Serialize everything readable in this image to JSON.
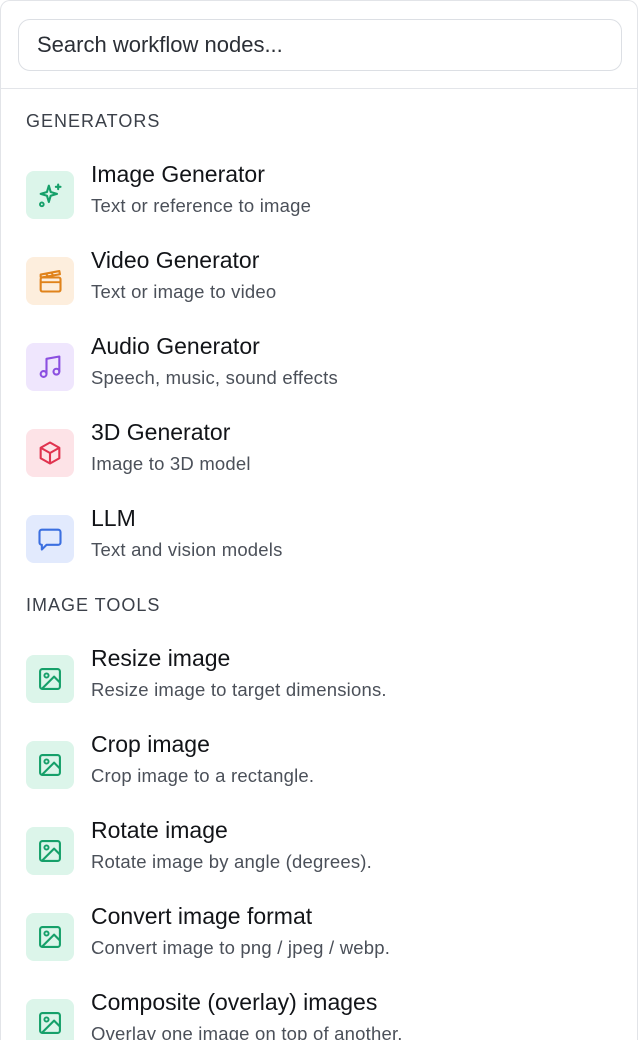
{
  "search": {
    "placeholder": "Search workflow nodes..."
  },
  "sections": [
    {
      "title": "GENERATORS",
      "items": [
        {
          "title": "Image Generator",
          "desc": "Text or reference to image",
          "icon": "sparkles-icon",
          "icon_color": "#16a06a",
          "icon_bg": "#dcf5ea"
        },
        {
          "title": "Video Generator",
          "desc": "Text or image to video",
          "icon": "clapperboard-icon",
          "icon_color": "#e0831b",
          "icon_bg": "#fdeedd"
        },
        {
          "title": "Audio Generator",
          "desc": "Speech, music, sound effects",
          "icon": "music-note-icon",
          "icon_color": "#8b4fe0",
          "icon_bg": "#efe6fd"
        },
        {
          "title": "3D Generator",
          "desc": "Image to 3D model",
          "icon": "cube-icon",
          "icon_color": "#e0334f",
          "icon_bg": "#fde3e7"
        },
        {
          "title": "LLM",
          "desc": "Text and vision models",
          "icon": "chat-bubble-icon",
          "icon_color": "#3b6fe0",
          "icon_bg": "#e2eafd"
        }
      ]
    },
    {
      "title": "IMAGE TOOLS",
      "items": [
        {
          "title": "Resize image",
          "desc": "Resize image to target dimensions.",
          "icon": "image-icon",
          "icon_color": "#16a06a",
          "icon_bg": "#dcf5ea"
        },
        {
          "title": "Crop image",
          "desc": "Crop image to a rectangle.",
          "icon": "image-icon",
          "icon_color": "#16a06a",
          "icon_bg": "#dcf5ea"
        },
        {
          "title": "Rotate image",
          "desc": "Rotate image by angle (degrees).",
          "icon": "image-icon",
          "icon_color": "#16a06a",
          "icon_bg": "#dcf5ea"
        },
        {
          "title": "Convert image format",
          "desc": "Convert image to png / jpeg / webp.",
          "icon": "image-icon",
          "icon_color": "#16a06a",
          "icon_bg": "#dcf5ea"
        },
        {
          "title": "Composite (overlay) images",
          "desc": "Overlay one image on top of another.",
          "icon": "image-icon",
          "icon_color": "#16a06a",
          "icon_bg": "#dcf5ea"
        }
      ]
    }
  ]
}
